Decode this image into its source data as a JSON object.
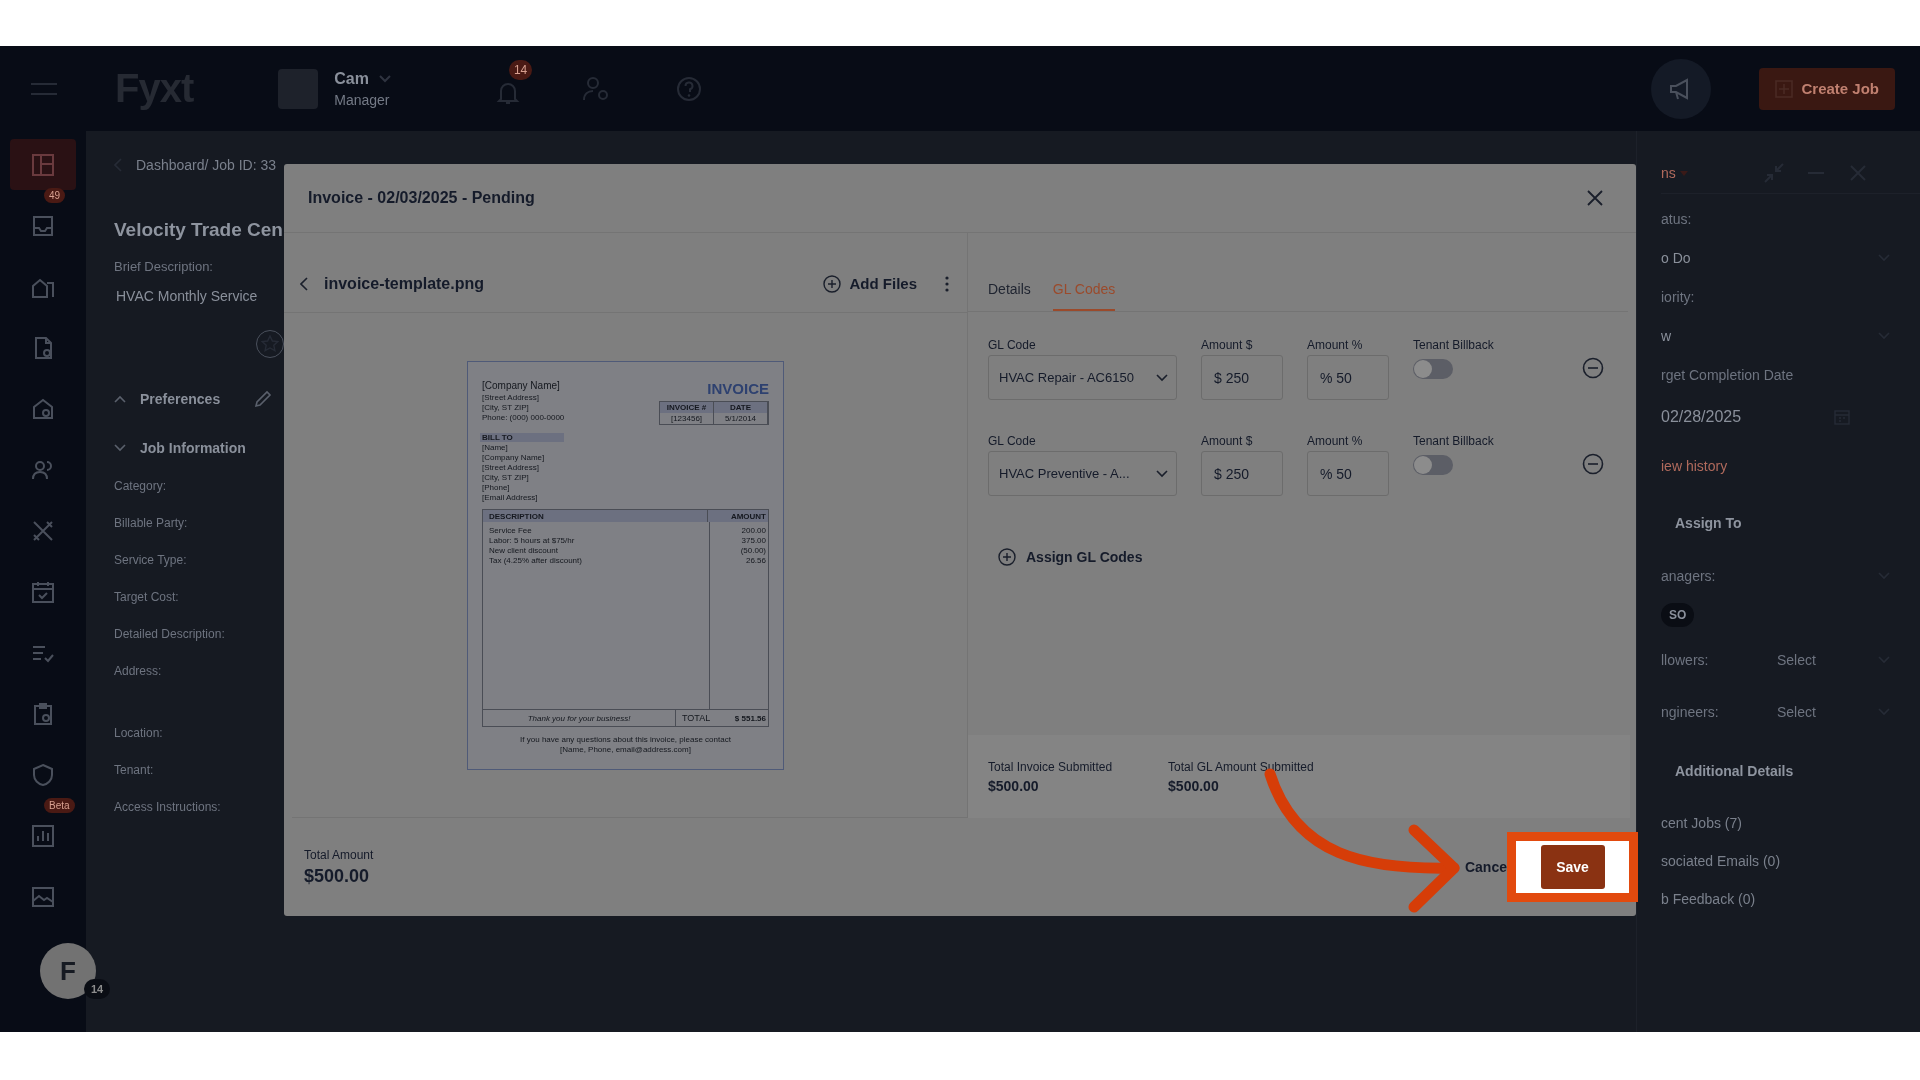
{
  "top_bar": {
    "logo": "Fyxt",
    "user": {
      "name": "Cam",
      "role": "Manager"
    },
    "notifications": "14",
    "create_button": "Create Job"
  },
  "sidebar": {
    "items": [
      {
        "kind": "grid",
        "selected": true
      },
      {
        "kind": "inbox",
        "selected": false,
        "badge": "49"
      },
      {
        "kind": "building",
        "selected": false
      },
      {
        "kind": "file",
        "selected": false
      },
      {
        "kind": "home",
        "selected": false
      },
      {
        "kind": "people",
        "selected": false
      },
      {
        "kind": "tools",
        "selected": false
      },
      {
        "kind": "calendar",
        "selected": false
      },
      {
        "kind": "checklist",
        "selected": false
      },
      {
        "kind": "clipboard",
        "selected": false
      },
      {
        "kind": "shield",
        "selected": false
      },
      {
        "kind": "chart",
        "selected": false,
        "badge": "Beta"
      },
      {
        "kind": "gallery",
        "selected": false
      }
    ],
    "profile": {
      "initial": "F",
      "badge": "14"
    }
  },
  "job_panel": {
    "breadcrumb": "Dashboard/ Job ID: 33",
    "title": "Velocity Trade Cen",
    "brief_label": "Brief Description:",
    "brief_value": "HVAC Monthly Service",
    "sections": [
      {
        "title": "Preferences",
        "expanded": false,
        "editable": true
      },
      {
        "title": "Job Information",
        "expanded": true,
        "editable": false
      }
    ],
    "fields": [
      "Category:",
      "Billable Party:",
      "Service Type:",
      "Target Cost:",
      "Detailed Description:",
      "Address:",
      "Location:",
      "Tenant:",
      "Access Instructions:"
    ]
  },
  "side_panel": {
    "actions_label": "ns",
    "fields": [
      {
        "kind": "label",
        "text": "atus:"
      },
      {
        "kind": "select",
        "text": "o Do"
      },
      {
        "kind": "label",
        "text": "iority:"
      },
      {
        "kind": "select",
        "text": "w"
      },
      {
        "kind": "label",
        "text": "rget Completion Date"
      },
      {
        "kind": "date",
        "text": "02/28/2025"
      },
      {
        "kind": "link",
        "text": "iew history"
      },
      {
        "kind": "heading",
        "text": "Assign To"
      },
      {
        "kind": "dropdown",
        "text": "anagers:"
      },
      {
        "kind": "chip",
        "text": "SO"
      },
      {
        "kind": "picker",
        "text": "llowers:",
        "placeholder": "Select"
      },
      {
        "kind": "picker",
        "text": "ngineers:",
        "placeholder": "Select"
      },
      {
        "kind": "heading",
        "text": "Additional Details"
      },
      {
        "kind": "stat",
        "text": "cent Jobs (7)"
      },
      {
        "kind": "stat",
        "text": "sociated Emails (0)"
      },
      {
        "kind": "stat",
        "text": "b Feedback (0)"
      }
    ]
  },
  "modal": {
    "title": "Invoice - 02/03/2025 - Pending",
    "file_name": "invoice-template.png",
    "add_files": "Add Files",
    "preview": {
      "company": "[Company Name]",
      "heading": "INVOICE",
      "sender_lines": [
        "[Street Address]",
        "[City, ST ZIP]",
        "Phone: (000) 000-0000"
      ],
      "meta_columns": [
        "INVOICE #",
        "DATE"
      ],
      "meta_values": [
        "[123456]",
        "5/1/2014"
      ],
      "bill_to_label": "BILL TO",
      "bill_to_lines": [
        "[Name]",
        "[Company Name]",
        "[Street Address]",
        "[City, ST ZIP]",
        "[Phone]",
        "[Email Address]"
      ],
      "columns": [
        "DESCRIPTION",
        "AMOUNT"
      ],
      "items": [
        {
          "description": "Service Fee",
          "amount": "200.00"
        },
        {
          "description": "Labor: 5 hours at $75/hr",
          "amount": "375.00"
        },
        {
          "description": "New client discount",
          "amount": "(50.00)"
        },
        {
          "description": "Tax (4.25% after discount)",
          "amount": "26.56"
        }
      ],
      "thanks": "Thank you for your business!",
      "total_label": "TOTAL",
      "total": "$ 551.56",
      "footer_lines": [
        "If you have any questions about this invoice, please contact",
        "[Name, Phone, email@address.com]"
      ]
    },
    "tabs": [
      {
        "label": "Details",
        "selected": false
      },
      {
        "label": "GL Codes",
        "selected": true
      }
    ],
    "gl_rows": [
      {
        "gl_label": "GL Code",
        "gl_value": "HVAC Repair - AC6150",
        "amount_label": "Amount $",
        "amount": "$ 250",
        "percent_label": "Amount %",
        "percent": "% 50",
        "billback_label": "Tenant Billback",
        "billback_on": false
      },
      {
        "gl_label": "GL Code",
        "gl_value": "HVAC Preventive - A...",
        "amount_label": "Amount $",
        "amount": "$ 250",
        "percent_label": "Amount %",
        "percent": "% 50",
        "billback_label": "Tenant Billback",
        "billback_on": false
      }
    ],
    "assign_button": "Assign GL Codes",
    "totals": [
      {
        "label": "Total Invoice Submitted",
        "value": "$500.00"
      },
      {
        "label": "Total GL Amount Submitted",
        "value": "$500.00"
      }
    ],
    "total_amount_label": "Total Amount",
    "total_amount": "$500.00",
    "cancel": "Cance",
    "save": "Save"
  },
  "tutorial": {
    "arrow": true,
    "highlight": true
  }
}
